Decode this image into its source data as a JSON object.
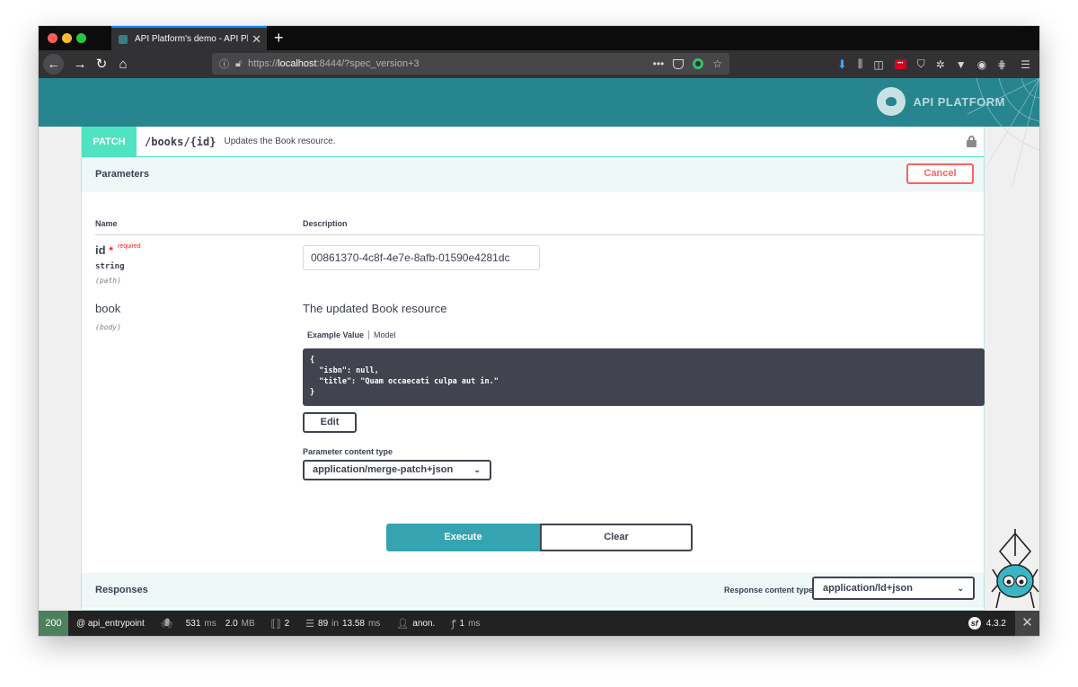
{
  "browser": {
    "tab_title": "API Platform's demo - API Platf",
    "tab_close": "✕",
    "new_tab": "+",
    "url_prefix": "https://",
    "url_host": "localhost",
    "url_rest": ":8444/?spec_version+3"
  },
  "header": {
    "logo_text": "API PLATFORM"
  },
  "operation": {
    "method": "PATCH",
    "path": "/books/{id}",
    "summary": "Updates the Book resource."
  },
  "parameters": {
    "title": "Parameters",
    "cancel_label": "Cancel",
    "col_name": "Name",
    "col_description": "Description",
    "id_param": {
      "name": "id",
      "star": "*",
      "required_label": "required",
      "type": "string",
      "in": "(path)",
      "value": "00861370-4c8f-4e7e-8afb-01590e4281dc"
    },
    "body_param": {
      "name": "book",
      "in": "(body)",
      "description": "The updated Book resource",
      "tab_example": "Example Value",
      "tab_model": "Model",
      "code_lines": [
        "{",
        "  \"isbn\": null,",
        "  \"title\": \"Quam occaecati culpa aut in.\"",
        "}"
      ],
      "edit_label": "Edit",
      "content_type_label": "Parameter content type",
      "content_type_value": "application/merge-patch+json"
    },
    "execute_label": "Execute",
    "clear_label": "Clear"
  },
  "responses": {
    "title": "Responses",
    "content_type_label": "Response content type",
    "content_type_value": "application/ld+json"
  },
  "debug_toolbar": {
    "status": "200",
    "route": "@ api_entrypoint",
    "time_value": "531",
    "time_unit": "ms",
    "memory_value": "2.0",
    "memory_unit": "MB",
    "requests_count": "2",
    "db_queries": "89",
    "db_in": "in",
    "db_time": "13.58",
    "db_unit": "ms",
    "user": "anon.",
    "render_value": "1",
    "render_unit": "ms",
    "sf_version": "4.3.2"
  },
  "colors": {
    "patch_accent": "#50e3c2",
    "header_teal": "#26858e",
    "cancel_red": "#ff6060",
    "execute_blue": "#35a4b0",
    "status_green": "#4f805d"
  }
}
